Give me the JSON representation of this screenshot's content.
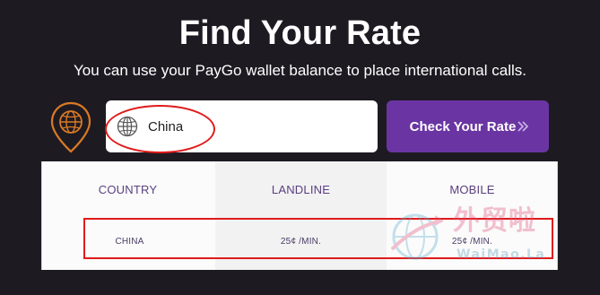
{
  "header": {
    "title": "Find Your Rate",
    "subtitle": "You can use your PayGo wallet balance to place international calls."
  },
  "search": {
    "value": "China",
    "button_label": "Check Your Rate"
  },
  "icons": {
    "location": "map-pin-globe-icon",
    "input": "globe-icon",
    "button": "double-chevron-right-icon"
  },
  "rates_table": {
    "headers": [
      "COUNTRY",
      "LANDLINE",
      "MOBILE"
    ],
    "rows": [
      [
        "CHINA",
        "25¢ /MIN.",
        "25¢ /MIN."
      ]
    ]
  },
  "watermark": {
    "text_cn": "外贸啦",
    "text_en": "WaiMao.La"
  },
  "colors": {
    "background": "#1e1a22",
    "accent_purple": "#6a35a3",
    "pin_orange": "#d97a25",
    "annotation_red": "#e01b1b",
    "header_text": "#5a3f7f"
  }
}
